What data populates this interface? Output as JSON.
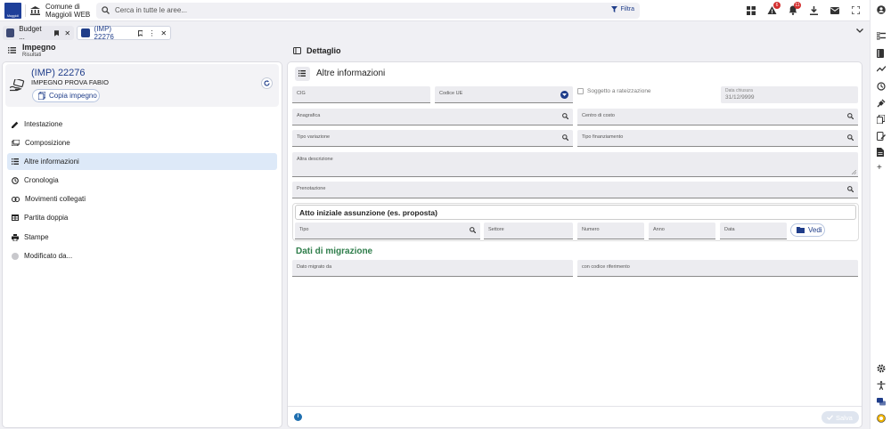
{
  "topbar": {
    "logo_text": "Maggioli",
    "org_line1": "Comune di",
    "org_line2": "Maggioli WEB",
    "search_placeholder": "Cerca in tutte le aree...",
    "filter_label": "Filtra",
    "alerts_badge": "6",
    "notifications_badge": "11"
  },
  "tabs": [
    {
      "label": "Budget ...",
      "active": false
    },
    {
      "label": "(IMP) 22276",
      "active": true
    }
  ],
  "left": {
    "heading": "Impegno",
    "subheading": "Risultati",
    "record_title": "(IMP) 22276",
    "record_subtitle": "IMPEGNO PROVA FABIO",
    "copy_label": "Copia impegno",
    "nav": [
      {
        "label": "Intestazione",
        "icon": "pencil-icon"
      },
      {
        "label": "Composizione",
        "icon": "composition-icon"
      },
      {
        "label": "Altre informazioni",
        "icon": "list-icon"
      },
      {
        "label": "Cronologia",
        "icon": "history-icon"
      },
      {
        "label": "Movimenti collegati",
        "icon": "link-icon"
      },
      {
        "label": "Partita doppia",
        "icon": "table-icon"
      },
      {
        "label": "Stampe",
        "icon": "printer-icon"
      },
      {
        "label": "Modificato da...",
        "icon": "avatar-icon"
      }
    ]
  },
  "detail": {
    "heading": "Dettaglio",
    "section_title": "Altre informazioni",
    "fields": {
      "cig": "CIG",
      "codice_ue": "Codice UE",
      "soggetto_rateizzazione": "Soggetto a rateizzazione",
      "data_chiusura_label": "Data chiusura",
      "data_chiusura_value": "31/12/9999",
      "anagrafica": "Anagrafica",
      "centro_costo": "Centro di costo",
      "tipo_variazione": "Tipo variazione",
      "tipo_finanziamento": "Tipo finanziamento",
      "altra_descrizione": "Altra descrizione",
      "prenotazione": "Prenotazione"
    },
    "atto": {
      "title": "Atto iniziale assunzione (es. proposta)",
      "tipo": "Tipo",
      "settore": "Settore",
      "numero": "Numero",
      "anno": "Anno",
      "data": "Data",
      "vedi_label": "Vedi"
    },
    "migrazione": {
      "title": "Dati di migrazione",
      "dato_migrato_da": "Dato migrato da",
      "codice_riferimento": "con codice riferimento"
    },
    "save_label": "Salva"
  },
  "colors": {
    "primary": "#1f3d8a",
    "migration_title": "#2e7d4a",
    "badge": "#d32f2f",
    "active_nav": "#dde9f8"
  }
}
